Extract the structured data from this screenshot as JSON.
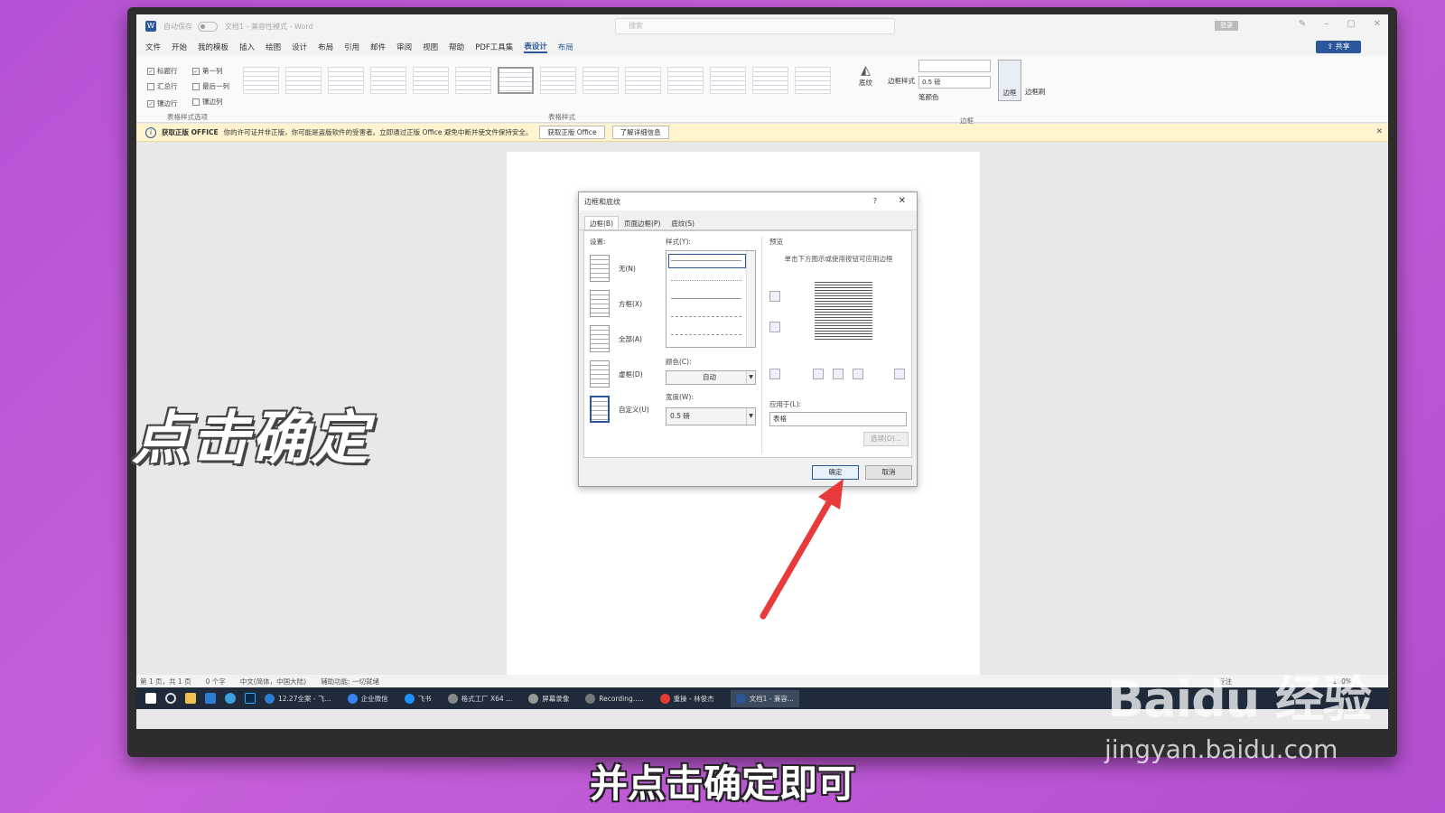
{
  "window": {
    "autosave": "自动保存",
    "autosave_state": "关",
    "doc_title": "文档1 - 兼容性模式 - Word",
    "search_placeholder": "搜索",
    "login": "登录",
    "share": "共享"
  },
  "menu": [
    "文件",
    "开始",
    "我的模板",
    "插入",
    "绘图",
    "设计",
    "布局",
    "引用",
    "邮件",
    "审阅",
    "视图",
    "帮助",
    "PDF工具集",
    "表设计",
    "布局"
  ],
  "menu_active_index": 13,
  "ribbon": {
    "options": [
      {
        "label": "标题行",
        "checked": true
      },
      {
        "label": "第一列",
        "checked": true
      },
      {
        "label": "汇总行",
        "checked": false
      },
      {
        "label": "最后一列",
        "checked": false
      },
      {
        "label": "镶边行",
        "checked": true
      },
      {
        "label": "镶边列",
        "checked": false
      }
    ],
    "options_group": "表格样式选项",
    "styles_group": "表格样式",
    "shading": "底纹",
    "border_styles": "边框样式",
    "pen_weight": "0.5 磅",
    "pen_color": "笔颜色",
    "borders": "边框",
    "border_painter": "边框刷",
    "borders_group": "边框"
  },
  "infobar": {
    "title": "获取正版 OFFICE",
    "message": "你的许可证并非正版，你可能是盗版软件的受害者。立即通过正版 Office 避免中断并使文件保持安全。",
    "btn_get": "获取正版 Office",
    "btn_learn": "了解详细信息"
  },
  "dialog": {
    "title": "边框和底纹",
    "help": "?",
    "tabs": [
      "边框(B)",
      "页面边框(P)",
      "底纹(S)"
    ],
    "settings_label": "设置:",
    "settings": [
      "无(N)",
      "方框(X)",
      "全部(A)",
      "虚框(D)",
      "自定义(U)"
    ],
    "style_label": "样式(Y):",
    "color_label": "颜色(C):",
    "color_value": "自动",
    "width_label": "宽度(W):",
    "width_value": "0.5 磅",
    "preview_label": "预览",
    "preview_note": "单击下方图示或使用按钮可应用边框",
    "apply_label": "应用于(L):",
    "apply_value": "表格",
    "options_button": "选项(O)...",
    "ok": "确定",
    "cancel": "取消"
  },
  "statusbar": {
    "page": "第 1 页，共 1 页",
    "words": "0 个字",
    "language": "中文(简体，中国大陆)",
    "accessibility": "辅助功能: 一切就绪",
    "focus": "专注",
    "zoom": "100%"
  },
  "taskbar": {
    "apps": [
      "12.27全案 - 飞...",
      "企业微信",
      "飞书",
      "格式工厂 X64 ...",
      "屏幕录像",
      "Recording.....",
      "重操 - 林俊杰",
      "文档1 - 兼容..."
    ]
  },
  "overlay": {
    "big_caption": "点击确定",
    "subtitle": "并点击确定即可",
    "watermark_logo": "Baidu 经验",
    "watermark_url": "jingyan.baidu.com"
  },
  "colors": {
    "accent": "#2b579a",
    "arrow": "#e83a3a",
    "background": "#c65fd8"
  }
}
